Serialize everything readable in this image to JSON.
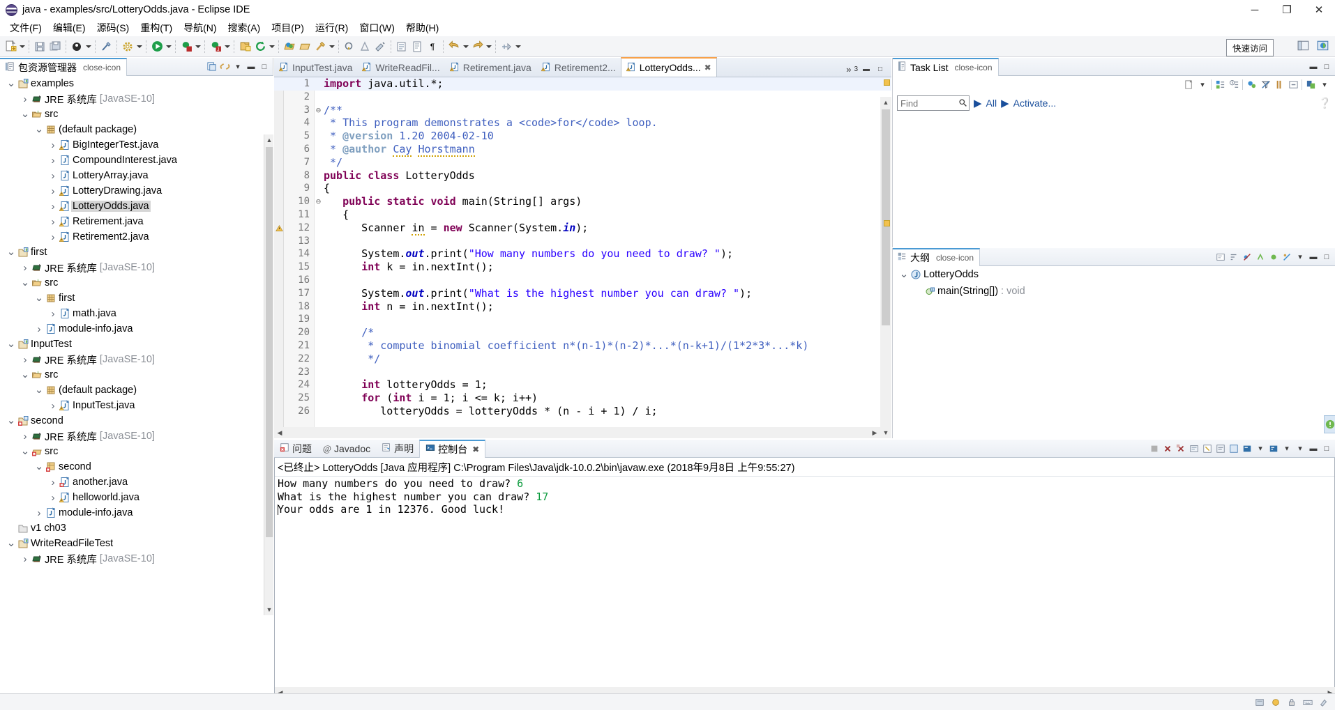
{
  "window": {
    "title": "java - examples/src/LotteryOdds.java - Eclipse IDE",
    "icon": "eclipse-logo-icon",
    "minimize": "─",
    "maximize": "❐",
    "close": "✕"
  },
  "menubar": {
    "items": [
      {
        "label": "文件(F)",
        "name": "menu-file"
      },
      {
        "label": "编辑(E)",
        "name": "menu-edit"
      },
      {
        "label": "源码(S)",
        "name": "menu-source"
      },
      {
        "label": "重构(T)",
        "name": "menu-refactor"
      },
      {
        "label": "导航(N)",
        "name": "menu-navigate"
      },
      {
        "label": "搜索(A)",
        "name": "menu-search"
      },
      {
        "label": "项目(P)",
        "name": "menu-project"
      },
      {
        "label": "运行(R)",
        "name": "menu-run"
      },
      {
        "label": "窗口(W)",
        "name": "menu-window"
      },
      {
        "label": "帮助(H)",
        "name": "menu-help"
      }
    ]
  },
  "toolbar": {
    "quick_access": "快速访问",
    "icons": [
      "new-wizard-icon",
      "save-icon",
      "save-all-icon",
      "print-icon",
      "toggle-mark-occurrences-icon",
      "build-icon",
      "run-icon",
      "debug-icon",
      "coverage-icon",
      "new-java-project-icon",
      "refresh-icon",
      "open-type-icon",
      "open-task-icon",
      "search-icon",
      "next-annotation-icon",
      "previous-annotation-icon",
      "last-edit-location-icon",
      "back-icon",
      "forward-icon"
    ]
  },
  "package_explorer": {
    "tab_label": "包资源管理器",
    "tab_icon": "package-explorer-icon",
    "close_icon": "close-icon",
    "tools": [
      "collapse-all-icon",
      "link-with-editor-icon",
      "view-menu-icon",
      "minimize-icon",
      "maximize-icon"
    ],
    "tree": [
      {
        "depth": 0,
        "twist": "v",
        "icon": "java-project-icon",
        "label": "examples",
        "dim": false,
        "selected": false
      },
      {
        "depth": 1,
        "twist": ">",
        "icon": "jre-library-icon",
        "label": "JRE 系统库",
        "suffix": "[JavaSE-10]",
        "dim": false,
        "selected": false
      },
      {
        "depth": 1,
        "twist": "v",
        "icon": "source-folder-icon",
        "label": "src",
        "dim": false,
        "selected": false
      },
      {
        "depth": 2,
        "twist": "v",
        "icon": "package-icon",
        "label": "(default package)",
        "dim": false,
        "selected": false
      },
      {
        "depth": 3,
        "twist": ">",
        "icon": "java-file-warning-icon",
        "label": "BigIntegerTest.java",
        "dim": false,
        "selected": false
      },
      {
        "depth": 3,
        "twist": ">",
        "icon": "java-file-icon",
        "label": "CompoundInterest.java",
        "dim": false,
        "selected": false
      },
      {
        "depth": 3,
        "twist": ">",
        "icon": "java-file-icon",
        "label": "LotteryArray.java",
        "dim": false,
        "selected": false
      },
      {
        "depth": 3,
        "twist": ">",
        "icon": "java-file-warning-icon",
        "label": "LotteryDrawing.java",
        "dim": false,
        "selected": false
      },
      {
        "depth": 3,
        "twist": ">",
        "icon": "java-file-warning-icon",
        "label": "LotteryOdds.java",
        "dim": false,
        "selected": true
      },
      {
        "depth": 3,
        "twist": ">",
        "icon": "java-file-warning-icon",
        "label": "Retirement.java",
        "dim": false,
        "selected": false
      },
      {
        "depth": 3,
        "twist": ">",
        "icon": "java-file-warning-icon",
        "label": "Retirement2.java",
        "dim": false,
        "selected": false
      },
      {
        "depth": 0,
        "twist": "v",
        "icon": "java-project-icon",
        "label": "first",
        "dim": false,
        "selected": false
      },
      {
        "depth": 1,
        "twist": ">",
        "icon": "jre-library-icon",
        "label": "JRE 系统库",
        "suffix": "[JavaSE-10]",
        "dim": false,
        "selected": false
      },
      {
        "depth": 1,
        "twist": "v",
        "icon": "source-folder-icon",
        "label": "src",
        "dim": false,
        "selected": false
      },
      {
        "depth": 2,
        "twist": "v",
        "icon": "package-icon",
        "label": "first",
        "dim": false,
        "selected": false
      },
      {
        "depth": 3,
        "twist": ">",
        "icon": "java-file-icon",
        "label": "math.java",
        "dim": false,
        "selected": false
      },
      {
        "depth": 2,
        "twist": ">",
        "icon": "java-file-icon",
        "label": "module-info.java",
        "dim": false,
        "selected": false
      },
      {
        "depth": 0,
        "twist": "v",
        "icon": "java-project-icon",
        "label": "InputTest",
        "dim": false,
        "selected": false
      },
      {
        "depth": 1,
        "twist": ">",
        "icon": "jre-library-icon",
        "label": "JRE 系统库",
        "suffix": "[JavaSE-10]",
        "dim": false,
        "selected": false
      },
      {
        "depth": 1,
        "twist": "v",
        "icon": "source-folder-icon",
        "label": "src",
        "dim": false,
        "selected": false
      },
      {
        "depth": 2,
        "twist": "v",
        "icon": "package-icon",
        "label": "(default package)",
        "dim": false,
        "selected": false
      },
      {
        "depth": 3,
        "twist": ">",
        "icon": "java-file-warning-icon",
        "label": "InputTest.java",
        "dim": false,
        "selected": false
      },
      {
        "depth": 0,
        "twist": "v",
        "icon": "java-project-error-icon",
        "label": "second",
        "dim": false,
        "selected": false
      },
      {
        "depth": 1,
        "twist": ">",
        "icon": "jre-library-icon",
        "label": "JRE 系统库",
        "suffix": "[JavaSE-10]",
        "dim": false,
        "selected": false
      },
      {
        "depth": 1,
        "twist": "v",
        "icon": "source-folder-error-icon",
        "label": "src",
        "dim": false,
        "selected": false
      },
      {
        "depth": 2,
        "twist": "v",
        "icon": "package-error-icon",
        "label": "second",
        "dim": false,
        "selected": false
      },
      {
        "depth": 3,
        "twist": ">",
        "icon": "java-file-error-icon",
        "label": "another.java",
        "dim": false,
        "selected": false
      },
      {
        "depth": 3,
        "twist": ">",
        "icon": "java-file-warning-icon",
        "label": "helloworld.java",
        "dim": false,
        "selected": false
      },
      {
        "depth": 2,
        "twist": ">",
        "icon": "java-file-icon",
        "label": "module-info.java",
        "dim": false,
        "selected": false
      },
      {
        "depth": 0,
        "twist": "",
        "icon": "project-closed-icon",
        "label": "v1 ch03",
        "dim": false,
        "selected": false
      },
      {
        "depth": 0,
        "twist": "v",
        "icon": "java-project-icon",
        "label": "WriteReadFileTest",
        "dim": false,
        "selected": false
      },
      {
        "depth": 1,
        "twist": ">",
        "icon": "jre-library-icon",
        "label": "JRE 系统库",
        "suffix": "[JavaSE-10]",
        "dim": false,
        "selected": false
      }
    ]
  },
  "editor": {
    "tabs": [
      {
        "label": "InputTest.java",
        "icon": "java-file-warning-icon",
        "active": false
      },
      {
        "label": "WriteReadFil...",
        "icon": "java-file-warning-icon",
        "active": false
      },
      {
        "label": "Retirement.java",
        "icon": "java-file-warning-icon",
        "active": false
      },
      {
        "label": "Retirement2...",
        "icon": "java-file-warning-icon",
        "active": false
      },
      {
        "label": "LotteryOdds...",
        "icon": "java-file-warning-icon",
        "active": true
      }
    ],
    "close_icon": "close-icon",
    "overflow_label": "»",
    "overflow_count": "3",
    "minimize_icon": "minimize-icon",
    "maximize_icon": "maximize-icon",
    "lines": [
      {
        "n": "1",
        "fold": "",
        "current": true,
        "marker": "",
        "html": "<span class=\"kw\">import</span> java.util.*;"
      },
      {
        "n": "2",
        "fold": "",
        "current": false,
        "marker": "",
        "html": ""
      },
      {
        "n": "3",
        "fold": "-",
        "current": false,
        "marker": "",
        "html": "<span class=\"cmt\">/**</span>"
      },
      {
        "n": "4",
        "fold": "",
        "current": false,
        "marker": "",
        "html": "<span class=\"cmt\"> * This program demonstrates a &lt;code&gt;for&lt;/code&gt; loop.</span>"
      },
      {
        "n": "5",
        "fold": "",
        "current": false,
        "marker": "",
        "html": "<span class=\"cmt\"> * </span><span class=\"cmtk\">@version</span><span class=\"cmt\"> 1.20 2004-02-10</span>"
      },
      {
        "n": "6",
        "fold": "",
        "current": false,
        "marker": "",
        "html": "<span class=\"cmt\"> * </span><span class=\"cmtk\">@author</span><span class=\"cmt\"> </span><span class=\"cmt sqg\">Cay</span><span class=\"cmt\"> </span><span class=\"cmt sqg\">Horstmann</span>"
      },
      {
        "n": "7",
        "fold": "",
        "current": false,
        "marker": "",
        "html": "<span class=\"cmt\"> */</span>"
      },
      {
        "n": "8",
        "fold": "",
        "current": false,
        "marker": "",
        "html": "<span class=\"kw\">public</span> <span class=\"kw\">class</span> LotteryOdds"
      },
      {
        "n": "9",
        "fold": "",
        "current": false,
        "marker": "",
        "html": "{"
      },
      {
        "n": "10",
        "fold": "-",
        "current": false,
        "marker": "",
        "html": "   <span class=\"kw\">public</span> <span class=\"kw\">static</span> <span class=\"kw\">void</span> main(String[] args)"
      },
      {
        "n": "11",
        "fold": "",
        "current": false,
        "marker": "",
        "html": "   {"
      },
      {
        "n": "12",
        "fold": "",
        "current": false,
        "marker": "warn",
        "html": "      Scanner <span class=\"sqg\">in</span> = <span class=\"kw\">new</span> Scanner(System.<span class=\"fld\">in</span>);"
      },
      {
        "n": "13",
        "fold": "",
        "current": false,
        "marker": "",
        "html": ""
      },
      {
        "n": "14",
        "fold": "",
        "current": false,
        "marker": "",
        "html": "      System.<span class=\"fld\">out</span>.print(<span class=\"str\">\"How many numbers do you need to draw? \"</span>);"
      },
      {
        "n": "15",
        "fold": "",
        "current": false,
        "marker": "",
        "html": "      <span class=\"kw\">int</span> k = in.nextInt();"
      },
      {
        "n": "16",
        "fold": "",
        "current": false,
        "marker": "",
        "html": ""
      },
      {
        "n": "17",
        "fold": "",
        "current": false,
        "marker": "",
        "html": "      System.<span class=\"fld\">out</span>.print(<span class=\"str\">\"What is the highest number you can draw? \"</span>);"
      },
      {
        "n": "18",
        "fold": "",
        "current": false,
        "marker": "",
        "html": "      <span class=\"kw\">int</span> n = in.nextInt();"
      },
      {
        "n": "19",
        "fold": "",
        "current": false,
        "marker": "",
        "html": ""
      },
      {
        "n": "20",
        "fold": "",
        "current": false,
        "marker": "",
        "html": "      <span class=\"cmt\">/*</span>"
      },
      {
        "n": "21",
        "fold": "",
        "current": false,
        "marker": "",
        "html": "      <span class=\"cmt\"> * compute binomial coefficient n*(n-1)*(n-2)*...*(n-k+1)/(1*2*3*...*k)</span>"
      },
      {
        "n": "22",
        "fold": "",
        "current": false,
        "marker": "",
        "html": "      <span class=\"cmt\"> */</span>"
      },
      {
        "n": "23",
        "fold": "",
        "current": false,
        "marker": "",
        "html": ""
      },
      {
        "n": "24",
        "fold": "",
        "current": false,
        "marker": "",
        "html": "      <span class=\"kw\">int</span> lotteryOdds = 1;"
      },
      {
        "n": "25",
        "fold": "",
        "current": false,
        "marker": "",
        "html": "      <span class=\"kw\">for</span> (<span class=\"kw\">int</span> i = 1; i &lt;= k; i++)"
      },
      {
        "n": "26",
        "fold": "",
        "current": false,
        "marker": "",
        "html": "         lotteryOdds = lotteryOdds * (n - i + 1) / i;"
      }
    ]
  },
  "console": {
    "tabs": [
      {
        "label": "问题",
        "icon": "problems-icon",
        "active": false
      },
      {
        "label": "Javadoc",
        "icon": "javadoc-icon",
        "active": false
      },
      {
        "label": "声明",
        "icon": "declaration-icon",
        "active": false
      },
      {
        "label": "控制台",
        "icon": "console-icon",
        "active": true
      }
    ],
    "close_icon": "close-icon",
    "tools": [
      "terminate-icon",
      "remove-launch-icon",
      "remove-all-terminated-icon",
      "scroll-lock-icon",
      "clear-console-icon",
      "word-wrap-icon",
      "pin-console-icon",
      "display-selected-console-icon",
      "open-console-icon",
      "view-menu-icon",
      "minimize-icon",
      "maximize-icon"
    ],
    "status_line": "<已终止> LotteryOdds [Java 应用程序] C:\\Program Files\\Java\\jdk-10.0.2\\bin\\javaw.exe  (2018年9月8日 上午9:55:27)",
    "output": [
      {
        "prompt": "How many numbers do you need to draw? ",
        "input": "6"
      },
      {
        "prompt": "What is the highest number you can draw? ",
        "input": "17"
      },
      {
        "prompt": "Your odds are 1 in 12376. Good luck!",
        "input": ""
      }
    ]
  },
  "task_list": {
    "tab_label": "Task List",
    "tab_icon": "task-list-icon",
    "close_icon": "close-icon",
    "tools": [
      "new-task-icon",
      "dropdown-icon",
      "categorize-icon",
      "schedule-icon",
      "focus-on-workweek-icon",
      "filter-icon",
      "presentation-icon",
      "collapse-all-icon",
      "synchronize-icon",
      "view-menu-icon",
      "minimize-icon",
      "maximize-icon"
    ],
    "find_placeholder": "Find",
    "find_value": "",
    "find_icon": "search-icon",
    "all_label": "All",
    "activate_label": "Activate...",
    "help_icon": "help-icon"
  },
  "outline": {
    "tab_label": "大纲",
    "tab_icon": "outline-icon",
    "close_icon": "close-icon",
    "tools": [
      "focus-on-active-task-icon",
      "sort-icon",
      "hide-fields-icon",
      "hide-static-icon",
      "hide-non-public-icon",
      "hide-local-types-icon",
      "link-with-editor-icon",
      "view-menu-icon",
      "minimize-icon",
      "maximize-icon"
    ],
    "tree": [
      {
        "depth": 0,
        "twist": "v",
        "icon": "java-class-icon",
        "label": "LotteryOdds",
        "suffix": ""
      },
      {
        "depth": 1,
        "twist": "",
        "icon": "public-static-method-icon",
        "label": "main(String[])",
        "suffix": ": void"
      }
    ]
  },
  "statusbar": {
    "icons": [
      "writable-icon",
      "smart-insert-icon",
      "lock-icon",
      "keyboard-icon",
      "misc-icon"
    ]
  },
  "colors": {
    "accent_blue": "#4a9ad4",
    "tab_active_orange": "#f7a14a",
    "keyword": "#7f0055",
    "string": "#2a00ff",
    "comment": "#3f5fbf",
    "javadoc_tag": "#7f9fbf",
    "static_field": "#0000c0",
    "console_input": "#0a9a3c",
    "selection_gray": "#d6d6d6",
    "toolbar_bg": "#f4f5f7"
  }
}
